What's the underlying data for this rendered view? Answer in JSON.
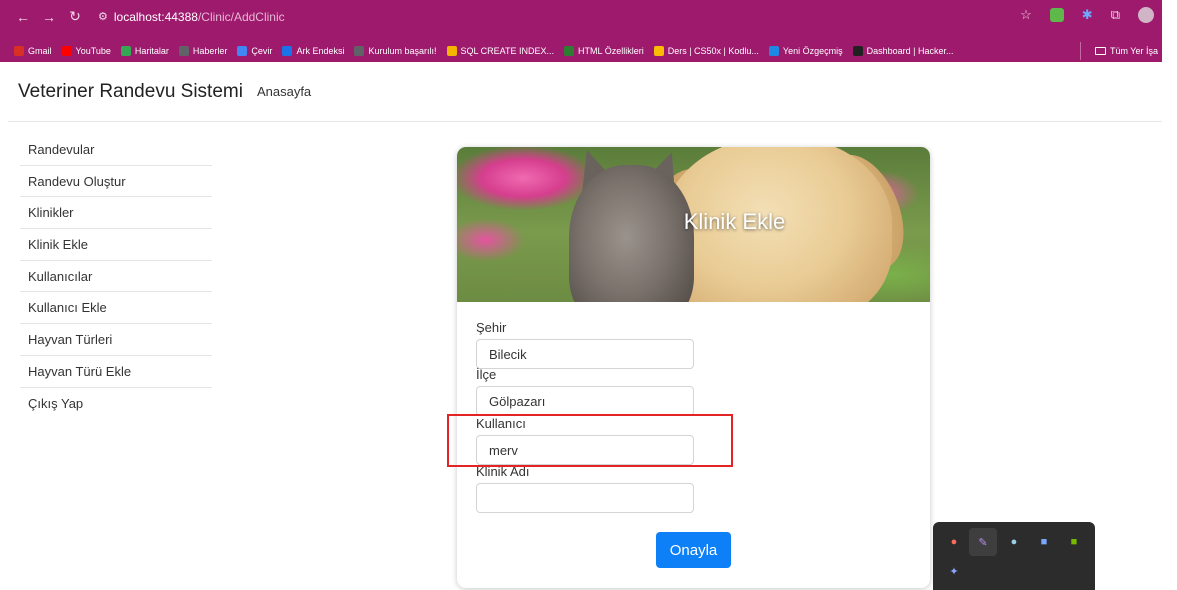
{
  "browser": {
    "url_host": "localhost:44388",
    "url_path": "/Clinic/AddClinic",
    "bookmarks": [
      {
        "label": "Gmail",
        "color": "#d93025"
      },
      {
        "label": "YouTube",
        "color": "#ff0000"
      },
      {
        "label": "Haritalar",
        "color": "#34a853"
      },
      {
        "label": "Haberler",
        "color": "#5f6368"
      },
      {
        "label": "Çevir",
        "color": "#4285f4"
      },
      {
        "label": "Ark Endeksi",
        "color": "#1a73e8"
      },
      {
        "label": "Kurulum başarılı!",
        "color": "#5f6368"
      },
      {
        "label": "SQL CREATE INDEX...",
        "color": "#f4b400"
      },
      {
        "label": "HTML Özellikleri",
        "color": "#2e7d32"
      },
      {
        "label": "Ders | CS50x | Kodlu...",
        "color": "#fbbc05"
      },
      {
        "label": "Yeni Özgeçmiş",
        "color": "#1e88e5"
      },
      {
        "label": "Dashboard | Hacker...",
        "color": "#212121"
      }
    ],
    "all_bookmarks_label": "Tüm Yer İşa"
  },
  "header": {
    "brand": "Veteriner Randevu Sistemi",
    "home_link": "Anasayfa"
  },
  "sidebar": {
    "items": [
      {
        "label": "Randevular"
      },
      {
        "label": "Randevu Oluştur"
      },
      {
        "label": "Klinikler"
      },
      {
        "label": "Klinik Ekle"
      },
      {
        "label": "Kullanıcılar"
      },
      {
        "label": "Kullanıcı Ekle"
      },
      {
        "label": "Hayvan Türleri"
      },
      {
        "label": "Hayvan Türü Ekle"
      },
      {
        "label": "Çıkış Yap"
      }
    ]
  },
  "card": {
    "title": "Klinik Ekle",
    "fields": [
      {
        "label": "Şehir",
        "value": "Bilecik"
      },
      {
        "label": "İlçe",
        "value": "Gölpazarı"
      },
      {
        "label": "Kullanıcı",
        "value": "merv"
      },
      {
        "label": "Klinik Adı",
        "value": ""
      }
    ],
    "submit_label": "Onayla"
  },
  "colors": {
    "browser_bar": "#9d1a6d",
    "primary_button": "#0d7ff7",
    "highlight": "#e22424"
  }
}
